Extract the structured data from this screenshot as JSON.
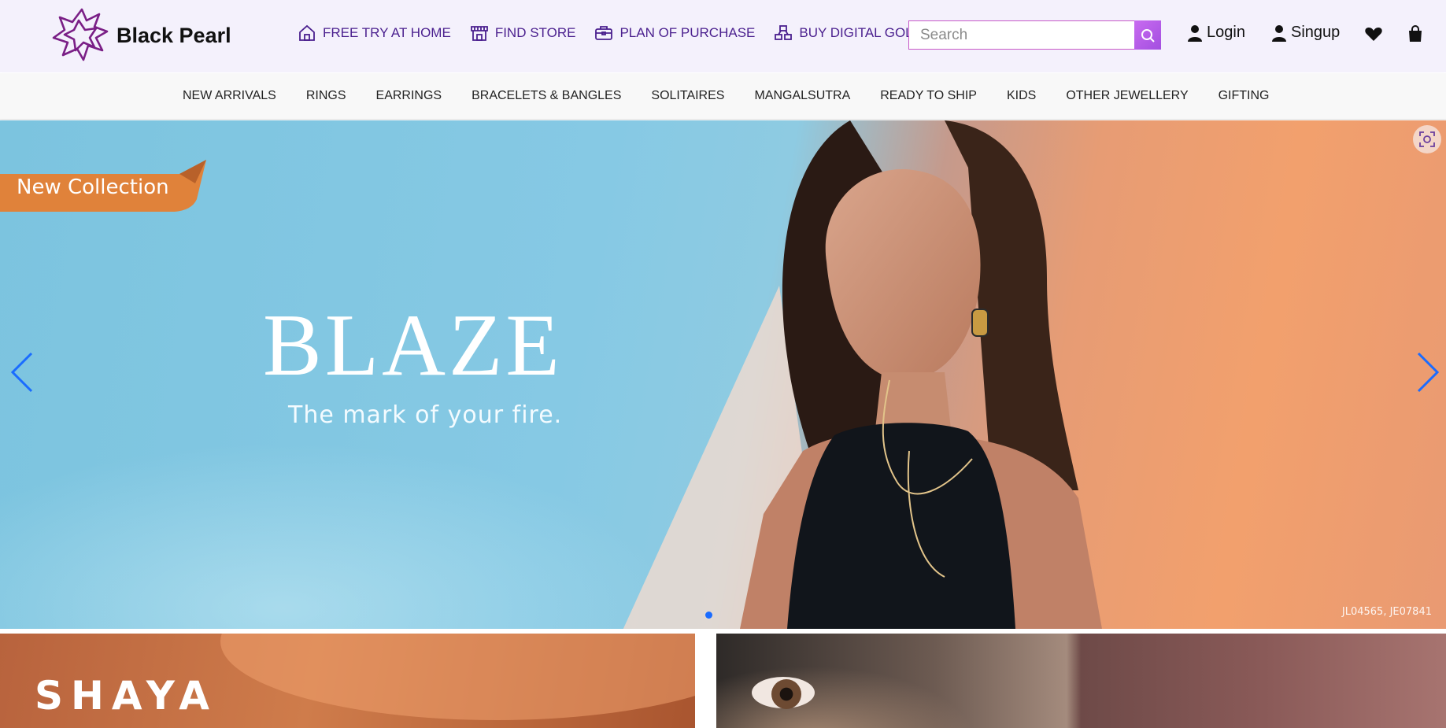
{
  "brand": {
    "name": "Black Pearl"
  },
  "quick_links": [
    {
      "label": "FREE TRY AT HOME",
      "icon": "home-icon"
    },
    {
      "label": "FIND STORE",
      "icon": "store-icon"
    },
    {
      "label": "PLAN OF PURCHASE",
      "icon": "briefcase-icon"
    },
    {
      "label": "BUY DIGITAL GOLD",
      "icon": "gold-bars-icon"
    }
  ],
  "search": {
    "placeholder": "Search",
    "value": ""
  },
  "account": {
    "login_label": "Login",
    "signup_label": "Singup"
  },
  "categories": [
    "NEW ARRIVALS",
    "RINGS",
    "EARRINGS",
    "BRACELETS & BANGLES",
    "SOLITAIRES",
    "MANGALSUTRA",
    "READY TO SHIP",
    "KIDS",
    "OTHER JEWELLERY",
    "GIFTING"
  ],
  "hero": {
    "ribbon": "New Collection",
    "title": "BLAZE",
    "subtitle": "The mark of your fire.",
    "product_codes": "JL04565, JE07841"
  },
  "tiles": {
    "left_title": "SHAYA"
  },
  "colors": {
    "accent_purple": "#4a1f8e",
    "search_button": "#b95ee8",
    "carousel_arrow": "#1a6cff",
    "ribbon_orange": "#e0823a"
  }
}
